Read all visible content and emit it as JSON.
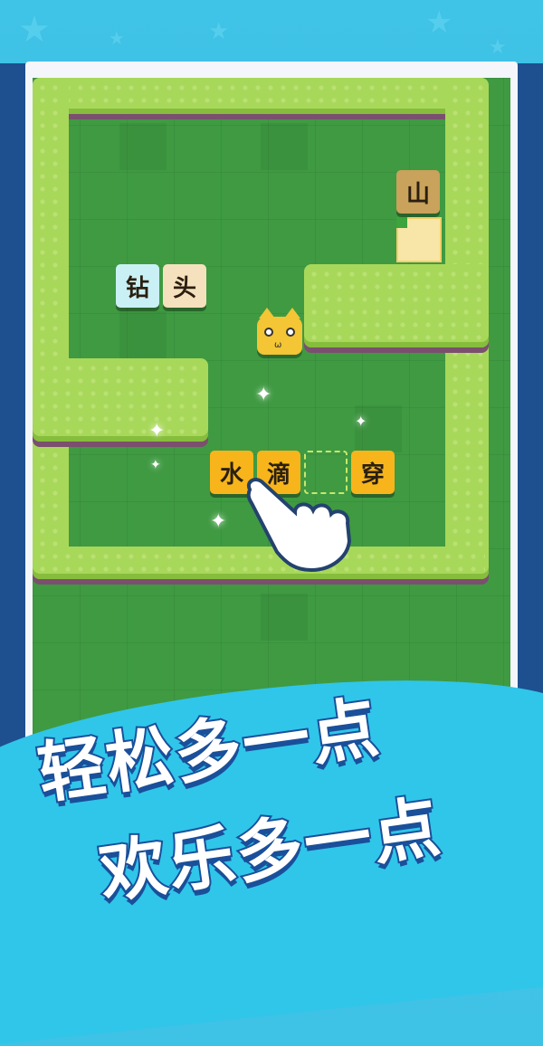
{
  "colors": {
    "background": "#3fc3e6",
    "grass": "#3f9a42",
    "hedge": "#a8d85a",
    "tile_yellow": "#f7b51b",
    "tile_cyan": "#c9f1f5",
    "tile_beige": "#f5e1bd",
    "tile_brown": "#c9a25c",
    "slogan_outline": "#1a4f9a"
  },
  "tiles": {
    "shan": "山",
    "zuan": "钻",
    "tou": "头",
    "shui": "水",
    "di": "滴",
    "chuan": "穿"
  },
  "slogan": {
    "line1": "轻松多一点",
    "line2": "欢乐多一点"
  },
  "icons": {
    "character": "cat-icon",
    "pointer": "hand-pointer-icon",
    "sparkle": "sparkle-icon"
  }
}
